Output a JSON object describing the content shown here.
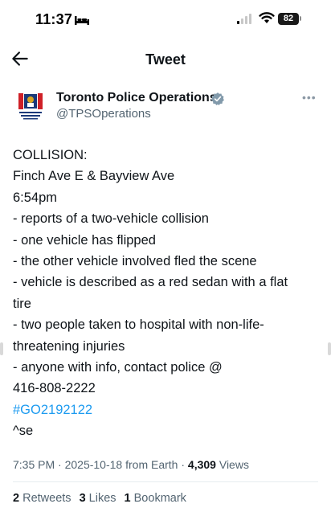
{
  "status_bar": {
    "time": "11:37",
    "battery": "82",
    "icons": [
      "bed-icon",
      "signal-icon",
      "wifi-icon",
      "battery-icon"
    ]
  },
  "header": {
    "title": "Tweet",
    "back_icon": "arrow-left-icon"
  },
  "tweet": {
    "author": {
      "name": "Toronto Police Operations",
      "handle": "@TPSOperations",
      "verified": true,
      "avatar": "toronto-police-operations-centre-logo"
    },
    "lines": [
      "COLLISION:",
      "Finch Ave E & Bayview Ave",
      "6:54pm",
      "- reports of a two-vehicle collision",
      "- one vehicle has flipped",
      "- the other vehicle involved fled the scene",
      "- vehicle is described as a red sedan with a flat",
      "tire",
      "- two people taken to hospital with non-life-",
      "threatening injuries",
      "- anyone with info, contact police @",
      "416-808-2222"
    ],
    "hashtag": "#GO2192122",
    "signoff": "^se",
    "meta": {
      "time": "7:35 PM",
      "sep1": " · ",
      "date": "2025-10-18",
      "source": " from Earth",
      "sep2": " · ",
      "views_count": "4,309",
      "views_label": " Views"
    },
    "stats": {
      "retweets_count": "2",
      "retweets_label": " Retweets",
      "likes_count": "3",
      "likes_label": " Likes",
      "bookmarks_count": "1",
      "bookmarks_label": " Bookmark"
    }
  },
  "colors": {
    "link": "#1d9bf0",
    "text": "#0f1419",
    "secondary": "#536471",
    "divider": "#e6ecf0"
  }
}
